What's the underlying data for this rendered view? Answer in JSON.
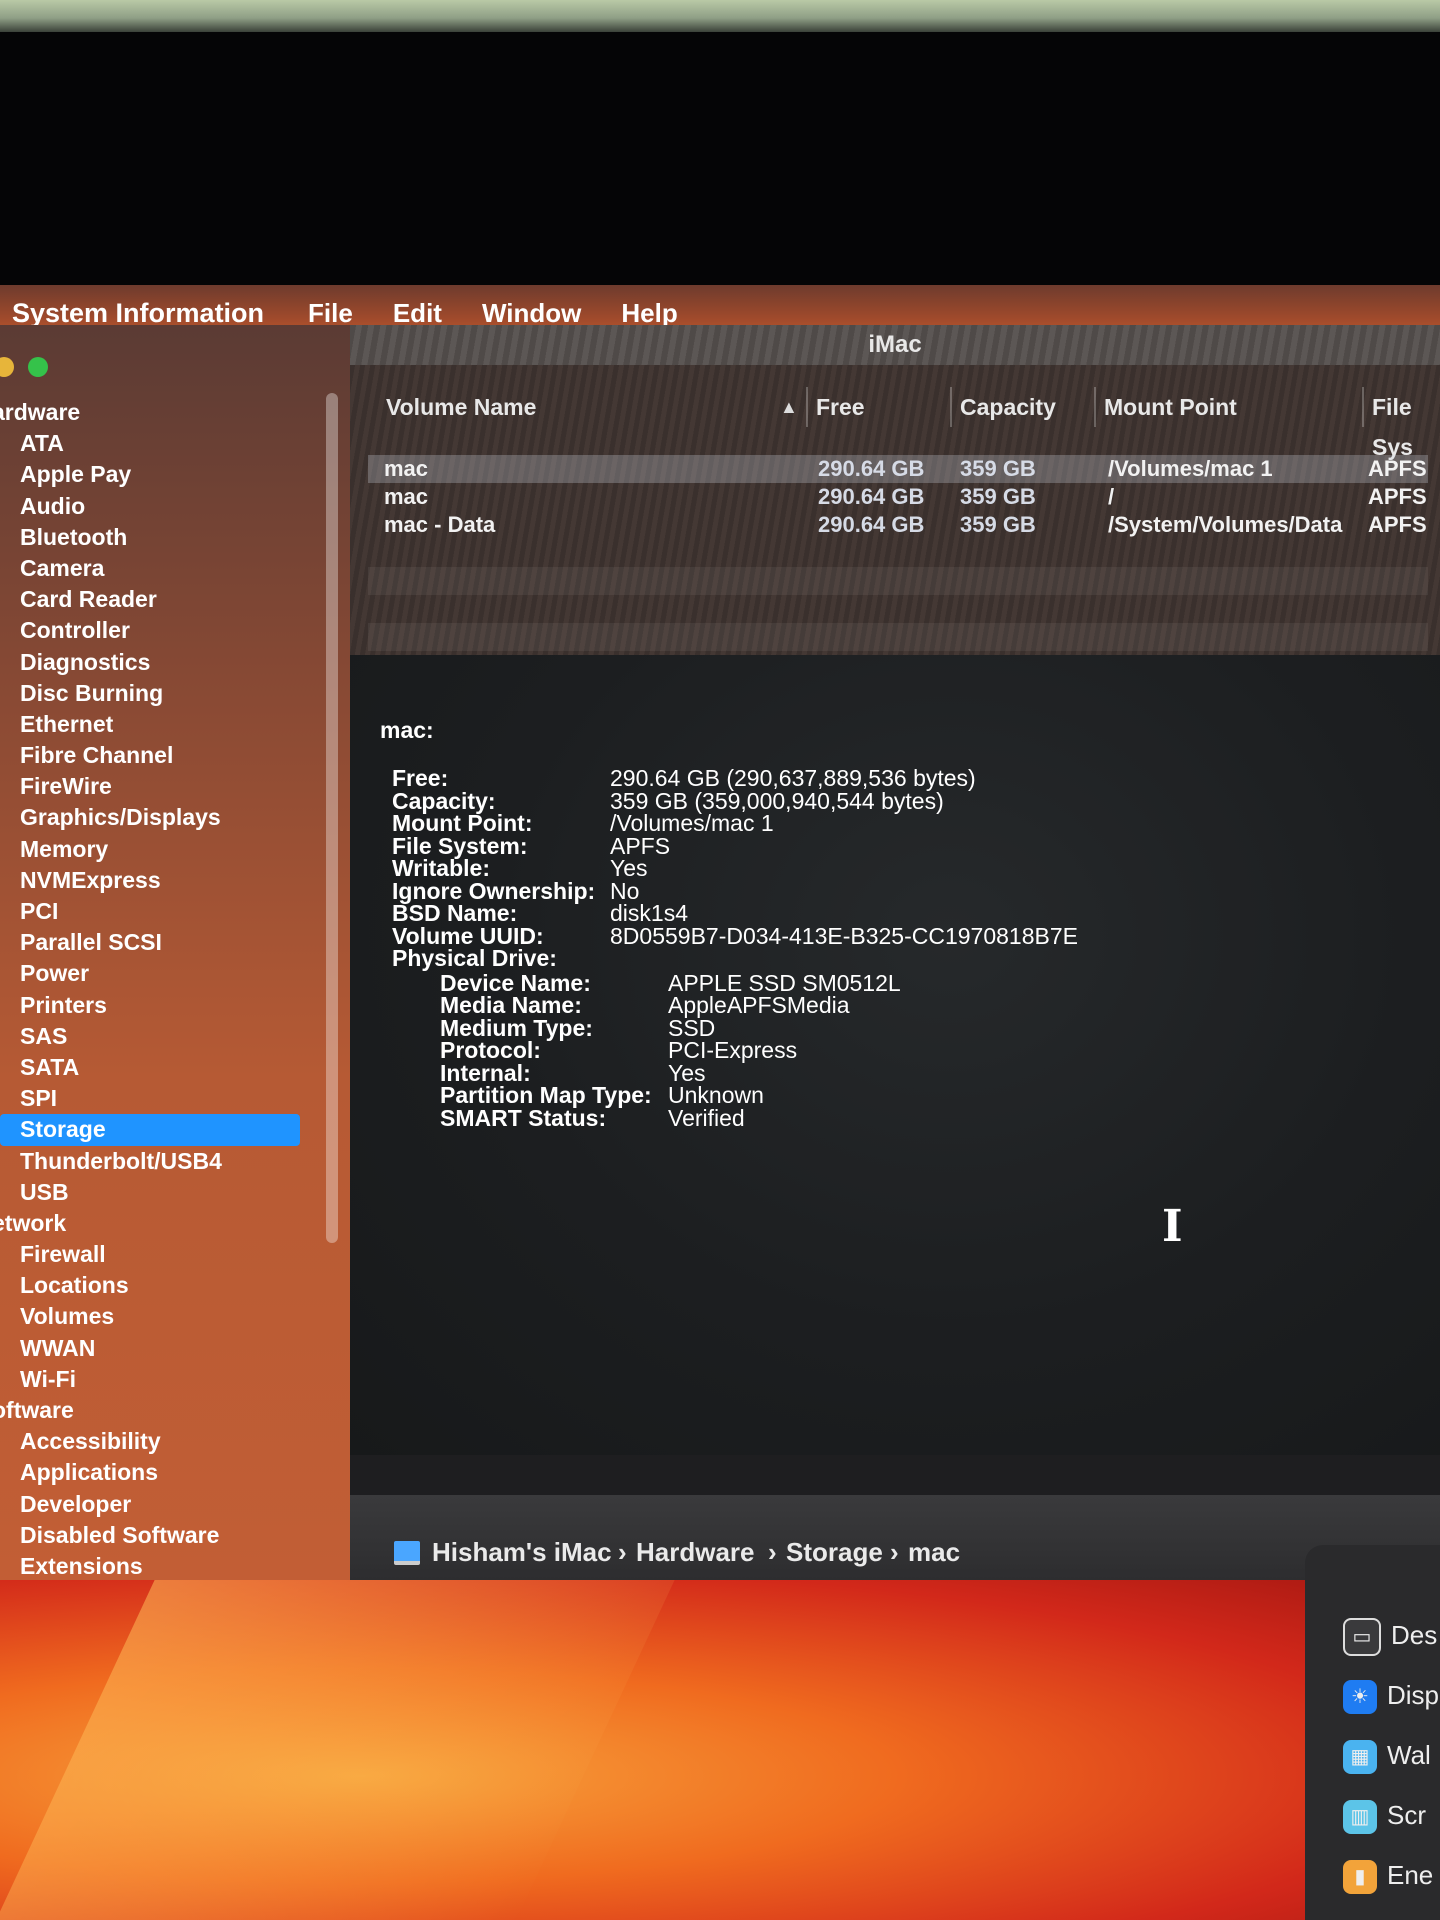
{
  "menubar": {
    "app": "System Information",
    "items": [
      "File",
      "Edit",
      "Window",
      "Help"
    ]
  },
  "window": {
    "title": "iMac"
  },
  "sidebar": {
    "items": [
      {
        "label": "ardware",
        "group": true
      },
      {
        "label": "ATA"
      },
      {
        "label": "Apple Pay"
      },
      {
        "label": "Audio"
      },
      {
        "label": "Bluetooth"
      },
      {
        "label": "Camera"
      },
      {
        "label": "Card Reader"
      },
      {
        "label": "Controller"
      },
      {
        "label": "Diagnostics"
      },
      {
        "label": "Disc Burning"
      },
      {
        "label": "Ethernet"
      },
      {
        "label": "Fibre Channel"
      },
      {
        "label": "FireWire"
      },
      {
        "label": "Graphics/Displays"
      },
      {
        "label": "Memory"
      },
      {
        "label": "NVMExpress"
      },
      {
        "label": "PCI"
      },
      {
        "label": "Parallel SCSI"
      },
      {
        "label": "Power"
      },
      {
        "label": "Printers"
      },
      {
        "label": "SAS"
      },
      {
        "label": "SATA"
      },
      {
        "label": "SPI"
      },
      {
        "label": "Storage",
        "selected": true
      },
      {
        "label": "Thunderbolt/USB4"
      },
      {
        "label": "USB"
      },
      {
        "label": "etwork",
        "group": true
      },
      {
        "label": "Firewall"
      },
      {
        "label": "Locations"
      },
      {
        "label": "Volumes"
      },
      {
        "label": "WWAN"
      },
      {
        "label": "Wi-Fi"
      },
      {
        "label": "oftware",
        "group": true
      },
      {
        "label": "Accessibility"
      },
      {
        "label": "Applications"
      },
      {
        "label": "Developer"
      },
      {
        "label": "Disabled Software"
      },
      {
        "label": "Extensions"
      }
    ]
  },
  "volumes": {
    "columns": {
      "name": "Volume Name",
      "free": "Free",
      "capacity": "Capacity",
      "mount": "Mount Point",
      "fs": "File Sys"
    },
    "rows": [
      {
        "name": "mac",
        "free": "290.64 GB",
        "capacity": "359 GB",
        "mount": "/Volumes/mac 1",
        "fs": "APFS",
        "selected": true
      },
      {
        "name": "mac",
        "free": "290.64 GB",
        "capacity": "359 GB",
        "mount": "/",
        "fs": "APFS"
      },
      {
        "name": "mac - Data",
        "free": "290.64 GB",
        "capacity": "359 GB",
        "mount": "/System/Volumes/Data",
        "fs": "APFS"
      }
    ]
  },
  "detail": {
    "title": "mac:",
    "fields": [
      {
        "label": "Free:",
        "value": "290.64 GB (290,637,889,536 bytes)"
      },
      {
        "label": "Capacity:",
        "value": "359 GB (359,000,940,544 bytes)"
      },
      {
        "label": "Mount Point:",
        "value": "/Volumes/mac 1"
      },
      {
        "label": "File System:",
        "value": "APFS"
      },
      {
        "label": "Writable:",
        "value": "Yes"
      },
      {
        "label": "Ignore Ownership:",
        "value": "No"
      },
      {
        "label": "BSD Name:",
        "value": "disk1s4"
      },
      {
        "label": "Volume UUID:",
        "value": "8D0559B7-D034-413E-B325-CC1970818B7E"
      },
      {
        "label": "Physical Drive:",
        "value": ""
      }
    ],
    "physical": [
      {
        "label": "Device Name:",
        "value": "APPLE SSD SM0512L"
      },
      {
        "label": "Media Name:",
        "value": "AppleAPFSMedia"
      },
      {
        "label": "Medium Type:",
        "value": "SSD"
      },
      {
        "label": "Protocol:",
        "value": "PCI-Express"
      },
      {
        "label": "Internal:",
        "value": "Yes"
      },
      {
        "label": "Partition Map Type:",
        "value": "Unknown"
      },
      {
        "label": "SMART Status:",
        "value": "Verified"
      }
    ]
  },
  "pathbar": {
    "items": [
      "Hisham's iMac",
      "Hardware",
      "Storage",
      "mac"
    ],
    "separator": "›"
  },
  "prefs": {
    "items": [
      {
        "label": "Des",
        "icon": "desktop-icon",
        "color": "#3a3a3c"
      },
      {
        "label": "Disp",
        "icon": "display-icon",
        "color": "#1f7cf2"
      },
      {
        "label": "Wal",
        "icon": "wallpaper-icon",
        "color": "#4ab3f0"
      },
      {
        "label": "Scr",
        "icon": "screensaver-icon",
        "color": "#5cc4e8"
      },
      {
        "label": "Ene",
        "icon": "energy-icon",
        "color": "#f2a33a"
      }
    ]
  }
}
